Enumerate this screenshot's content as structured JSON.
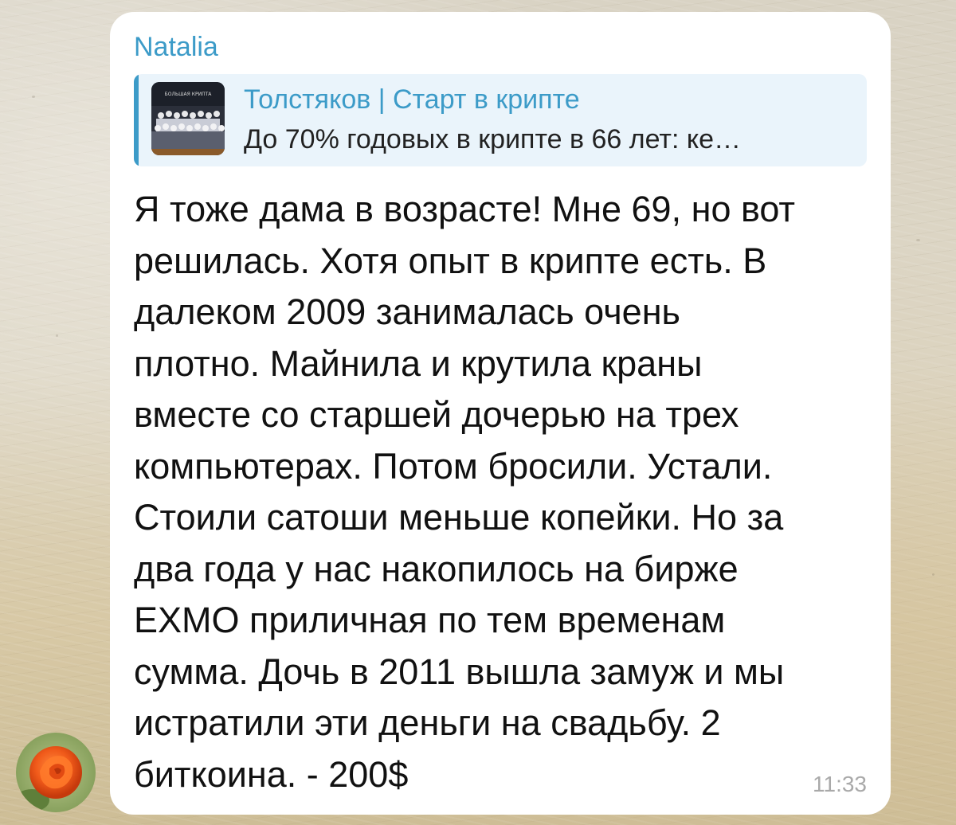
{
  "message": {
    "sender_name": "Natalia",
    "reply": {
      "channel_title": "Толстяков | Старт в крипте",
      "preview_text": "До 70% годовых в крипте в 66 лет: ке…",
      "thumbnail_icon": "group-photo-thumbnail",
      "thumbnail_caption": "БОЛЬШАЯ КРИПТА"
    },
    "text_lines": [
      "Я тоже дама в возрасте! Мне 69, но вот",
      "решилась. Хотя опыт в крипте есть. В",
      "далеком 2009 занималась очень",
      "плотно. Майнила и крутила краны",
      "вместе со старшей дочерью на трех",
      "компьютерах. Потом бросили. Устали.",
      "Стоили сатоши меньше копейки. Но за",
      "два года у нас накопилось на бирже",
      "EXMO приличная по тем временам",
      "сумма. Дочь в 2011 вышла замуж и мы",
      "истратили эти деньги на свадьбу. 2",
      "биткоина. - 200$"
    ],
    "time": "11:33"
  },
  "avatar": {
    "icon": "rose-avatar-icon"
  },
  "colors": {
    "accent": "#3c9bc8",
    "reply_background": "#eaf4fb",
    "bubble_background": "#ffffff",
    "time_text": "#a9a9a9"
  }
}
